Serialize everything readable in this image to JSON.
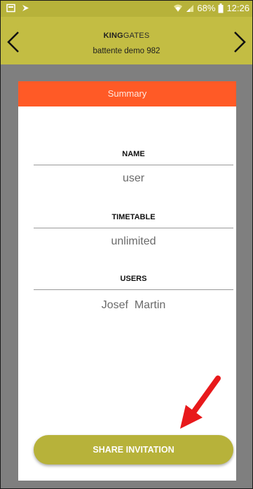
{
  "status_bar": {
    "battery_percent": "68%",
    "time": "12:26"
  },
  "header": {
    "brand_part1": "KING",
    "brand_part2": "GATES",
    "subtitle": "battente demo 982",
    "bg_color": "#c3bd43"
  },
  "summary": {
    "title": "Summary",
    "fields": [
      {
        "label": "NAME",
        "value": "user"
      },
      {
        "label": "TIMETABLE",
        "value": "unlimited"
      },
      {
        "label": "USERS",
        "value": "Josef  Martin"
      }
    ]
  },
  "actions": {
    "share_label": "SHARE INVITATION"
  },
  "colors": {
    "accent_orange": "#ff5a26",
    "olive": "#b7b23a",
    "annotation_red": "#e8191b"
  },
  "icons": {
    "status_left": [
      "notification-icon",
      "cast-icon"
    ],
    "status_right": [
      "wifi-icon",
      "signal-icon",
      "battery-icon"
    ],
    "nav": [
      "chevron-left-icon",
      "chevron-right-icon"
    ]
  }
}
